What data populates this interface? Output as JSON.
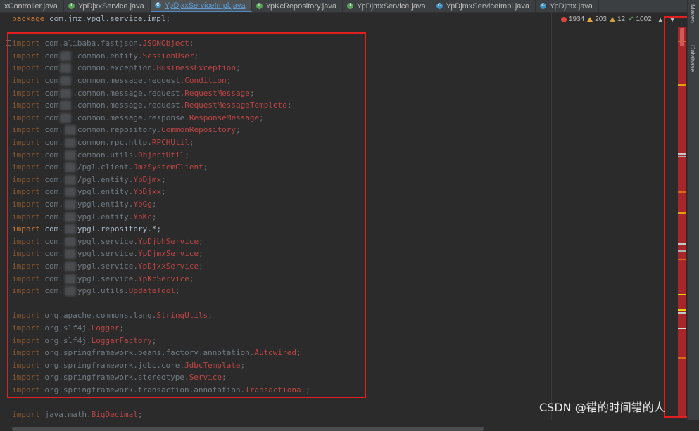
{
  "tabs": [
    {
      "label": "xController.java",
      "icon": "none",
      "active": false
    },
    {
      "label": "YpDjxxService.java",
      "icon": "green-interface-icon",
      "active": false
    },
    {
      "label": "YpDjxxServiceImpl.java",
      "icon": "blue-class-icon",
      "active": true
    },
    {
      "label": "YpKcRepository.java",
      "icon": "green-interface-icon",
      "active": false
    },
    {
      "label": "YpDjmxService.java",
      "icon": "green-interface-icon",
      "active": false
    },
    {
      "label": "YpDjmxServiceImpl.java",
      "icon": "blue-class-icon",
      "active": false
    },
    {
      "label": "YpDjmx.java",
      "icon": "blue-class-icon",
      "active": false
    }
  ],
  "inspections": {
    "errors": "1934",
    "warnings": "203",
    "weak_warnings": "12",
    "ok": "1002"
  },
  "side_panel": {
    "maven": "Maven",
    "database": "Database"
  },
  "code": {
    "package_line": {
      "kw": "package",
      "text": "com.jmz.ypgl.service.impl;"
    },
    "imports": [
      {
        "pre": "com.alibaba.fastjson.",
        "cls": "JSONObject",
        "blur": false
      },
      {
        "pre": "com",
        "post": ".common.entity.",
        "cls": "SessionUser",
        "blur": true
      },
      {
        "pre": "com",
        "post": ".common.exception.",
        "cls": "BusinessException",
        "blur": true
      },
      {
        "pre": "com",
        "post": ".common.message.request.",
        "cls": "Condition",
        "blur": true
      },
      {
        "pre": "com",
        "post": ".common.message.request.",
        "cls": "RequestMessage",
        "blur": true
      },
      {
        "pre": "com",
        "post": ".common.message.request.",
        "cls": "RequestMessageTemplete",
        "blur": true
      },
      {
        "pre": "com",
        "post": ".common.message.response.",
        "cls": "ResponseMessage",
        "blur": true
      },
      {
        "pre": "com.",
        "post": "common.repository.",
        "cls": "CommonRepository",
        "blur": true
      },
      {
        "pre": "com.",
        "post": "common.rpc.http.",
        "cls": "RPCHUtil",
        "blur": true
      },
      {
        "pre": "com.",
        "post": "common.utils.",
        "cls": "ObjectUtil",
        "blur": true
      },
      {
        "pre": "com.",
        "post": "/pgl.client.",
        "cls": "JmzSystemClient",
        "blur": true
      },
      {
        "pre": "com.",
        "post": "/pgl.entity.",
        "cls": "YpDjmx",
        "blur": true
      },
      {
        "pre": "com.",
        "post": "ypgl.entity.",
        "cls": "YpDjxx",
        "blur": true
      },
      {
        "pre": "com.",
        "post": "ypgl.entity.",
        "cls": "YpGg",
        "blur": true
      },
      {
        "pre": "com.",
        "post": "ypgl.entity.",
        "cls": "YpKc",
        "blur": true
      },
      {
        "pre": "com.",
        "post": "ypgl.repository.*;",
        "cls": "",
        "blur": true,
        "bright": true
      },
      {
        "pre": "com.",
        "post": "ypgl.service.",
        "cls": "YpDjbhService",
        "blur": true
      },
      {
        "pre": "com.",
        "post": "ypgl.service.",
        "cls": "YpDjmxService",
        "blur": true
      },
      {
        "pre": "com.",
        "post": "ypgl.service.",
        "cls": "YpDjxxService",
        "blur": true
      },
      {
        "pre": "com.",
        "post": "ypgl.service.",
        "cls": "YpKcService",
        "blur": true
      },
      {
        "pre": "com.",
        "post": "ypgl.utils.",
        "cls": "UpdateTool",
        "blur": true
      },
      {
        "pre": "org.apache.commons.lang.",
        "cls": "StringUtils",
        "blur": false,
        "gap_before": true
      },
      {
        "pre": "org.slf4j.",
        "cls": "Logger",
        "blur": false
      },
      {
        "pre": "org.slf4j.",
        "cls": "LoggerFactory",
        "blur": false
      },
      {
        "pre": "org.springframework.beans.factory.annotation.",
        "cls": "Autowired",
        "blur": false
      },
      {
        "pre": "org.springframework.jdbc.core.",
        "cls": "JdbcTemplate",
        "blur": false
      },
      {
        "pre": "org.springframework.stereotype.",
        "cls": "Service",
        "blur": false
      },
      {
        "pre": "org.springframework.transaction.annotation.",
        "cls": "Transactional",
        "blur": false
      },
      {
        "pre": "java.math.",
        "cls": "BigDecimal",
        "blur": false,
        "gap_before": true
      }
    ],
    "import_keyword": "import"
  },
  "watermark": "CSDN @错的时间错的人"
}
